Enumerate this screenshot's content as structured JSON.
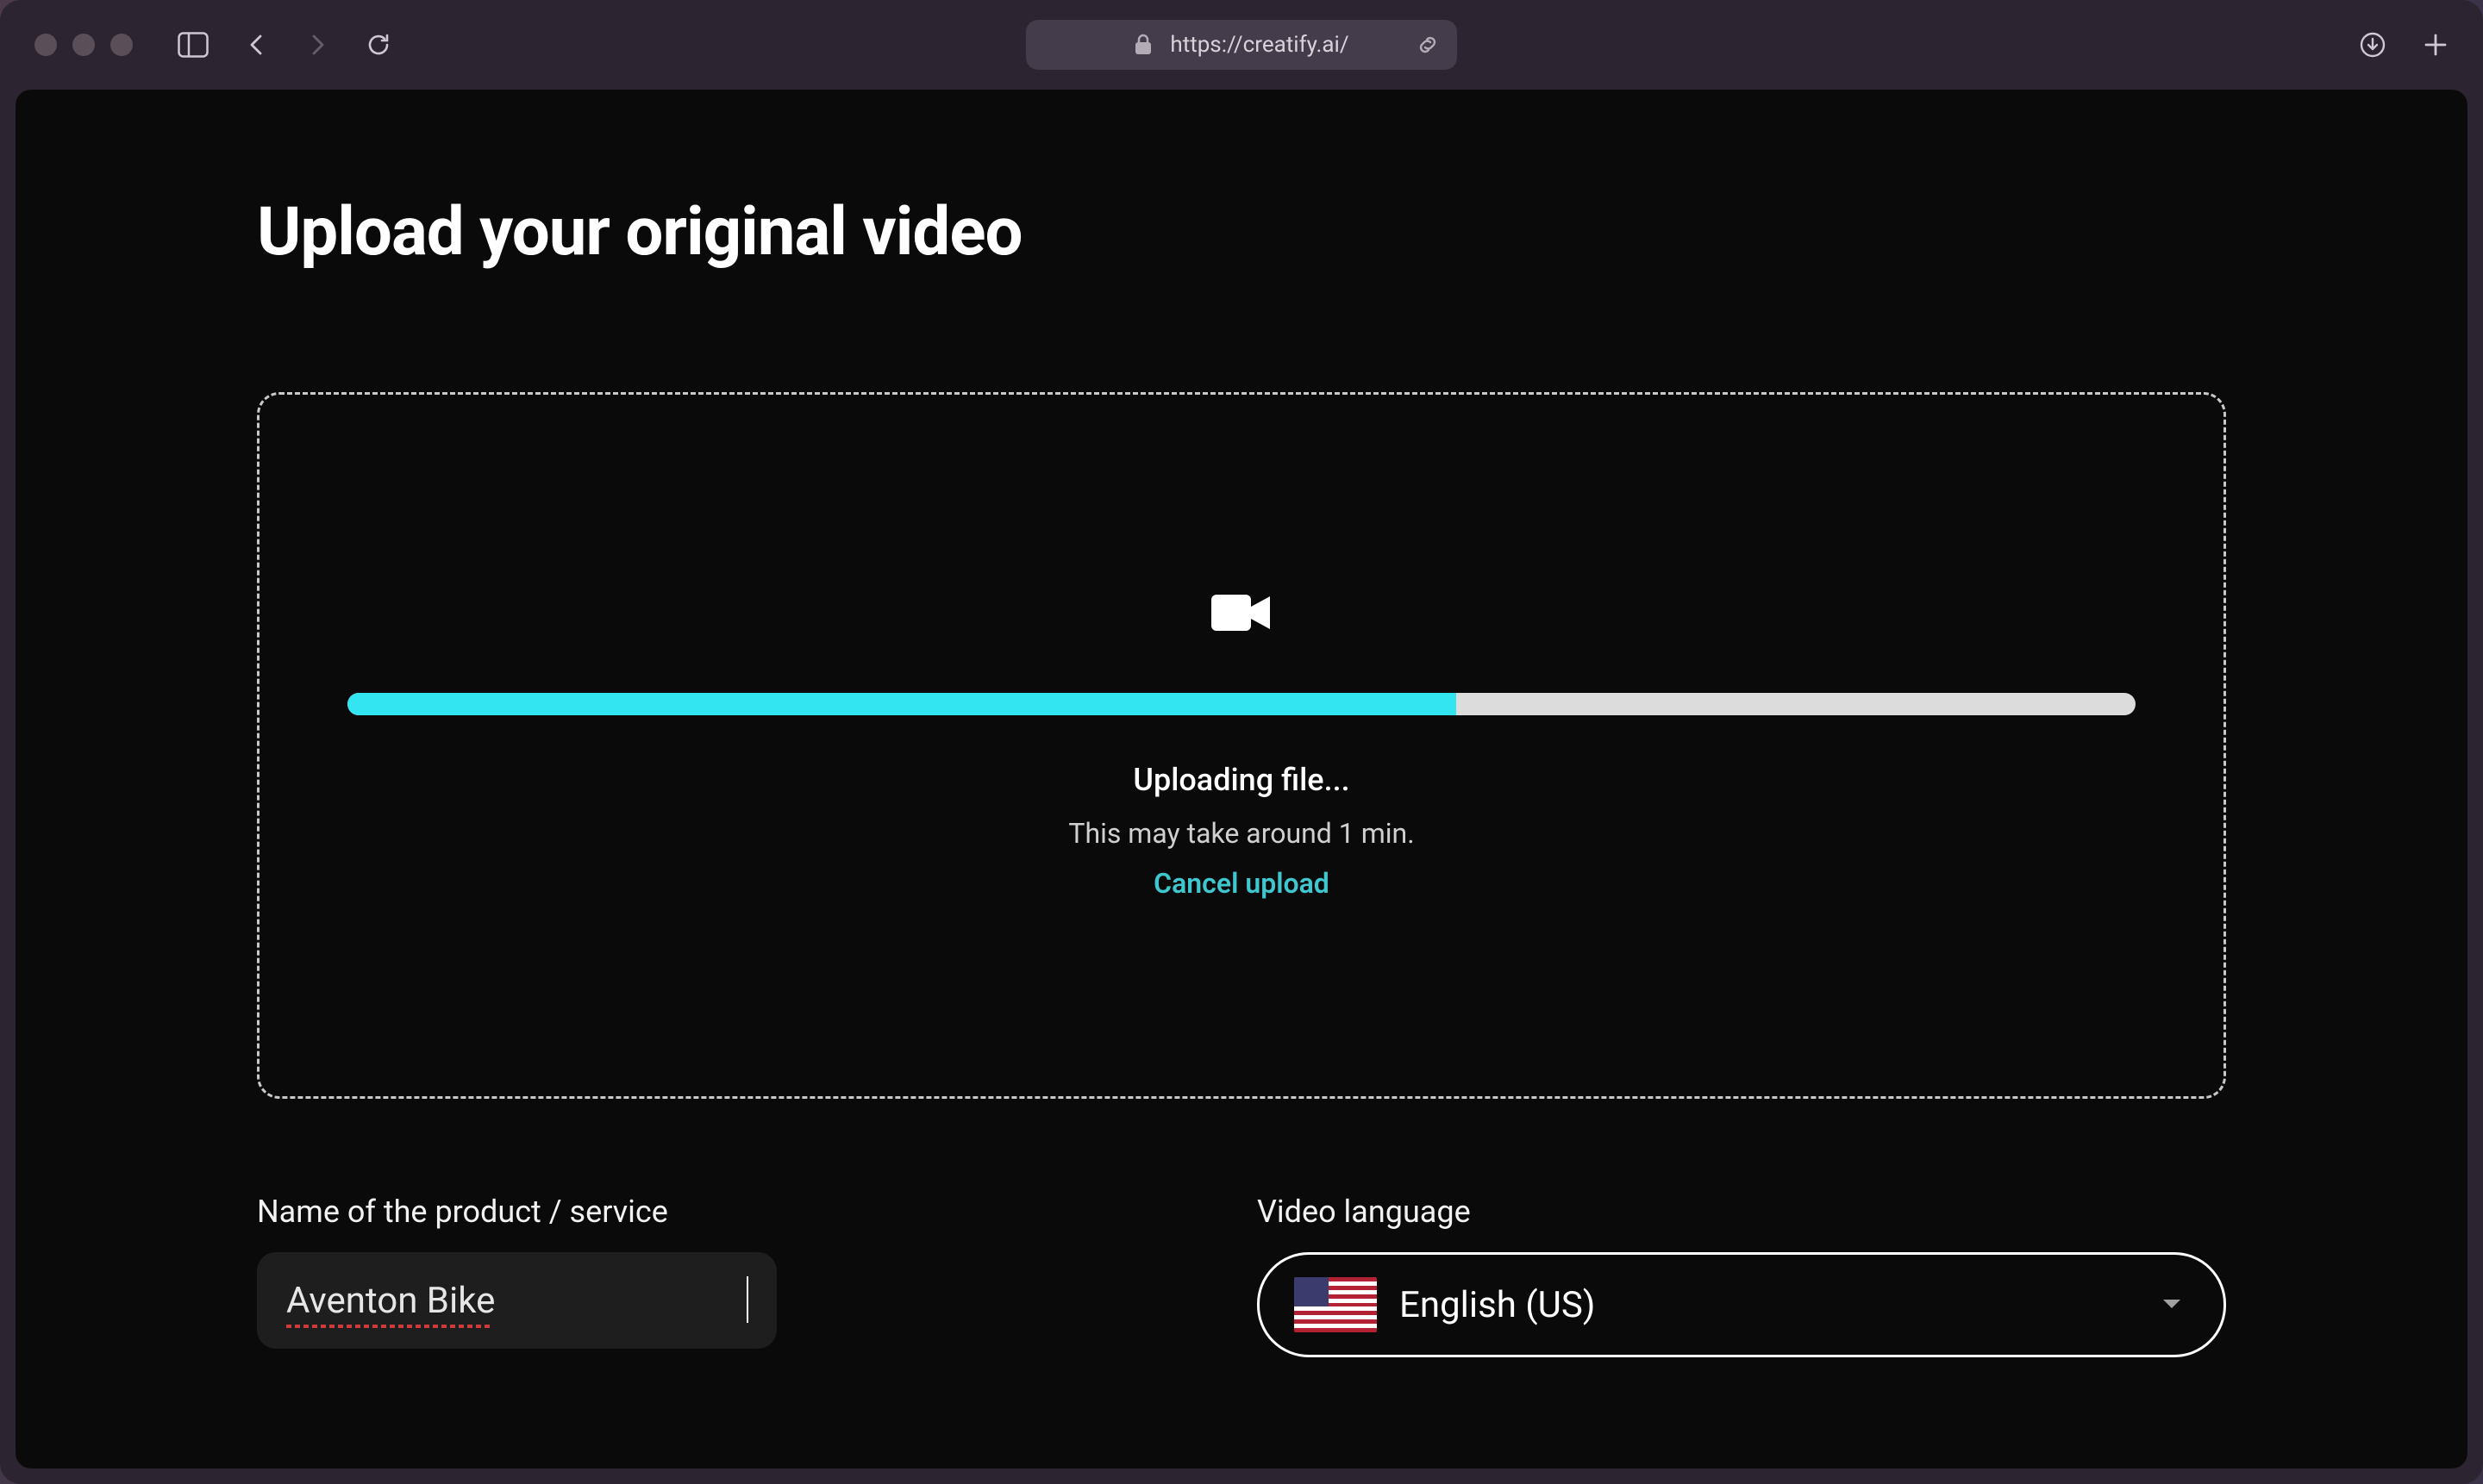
{
  "browser": {
    "url": "https://creatify.ai/"
  },
  "page": {
    "title": "Upload your original video"
  },
  "upload": {
    "progress_percent": 62,
    "status": "Uploading file...",
    "hint": "This may take around 1 min.",
    "cancel_label": "Cancel upload"
  },
  "form": {
    "name_label": "Name of the product / service",
    "name_value": "Aventon Bike",
    "language_label": "Video language",
    "language_value": "English (US)",
    "language_flag": "us"
  },
  "colors": {
    "accent": "#33e5f0",
    "link": "#3fc7d0",
    "bg": "#0a0a0a"
  }
}
